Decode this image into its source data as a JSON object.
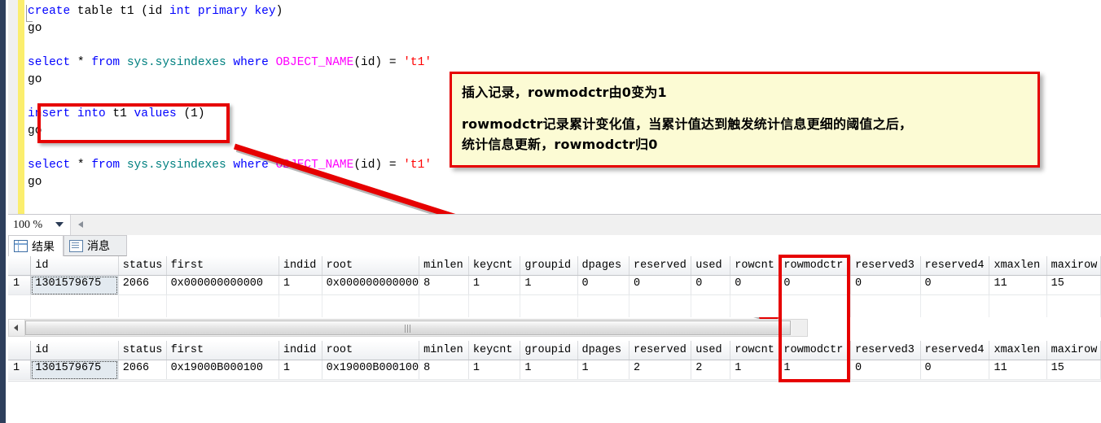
{
  "editor": {
    "lines": [
      [
        {
          "t": "create",
          "c": "kw"
        },
        {
          "t": " table t1 (id ",
          "c": "pl"
        },
        {
          "t": "int",
          "c": "kw"
        },
        {
          "t": " ",
          "c": "pl"
        },
        {
          "t": "primary key",
          "c": "kw"
        },
        {
          "t": ")",
          "c": "pl"
        }
      ],
      [
        {
          "t": "go",
          "c": "pl"
        }
      ],
      [],
      [
        {
          "t": "select",
          "c": "kw"
        },
        {
          "t": " * ",
          "c": "pl"
        },
        {
          "t": "from",
          "c": "kw"
        },
        {
          "t": " ",
          "c": "pl"
        },
        {
          "t": "sys.sysindexes",
          "c": "obj"
        },
        {
          "t": " ",
          "c": "pl"
        },
        {
          "t": "where",
          "c": "kw"
        },
        {
          "t": " ",
          "c": "pl"
        },
        {
          "t": "OBJECT_NAME",
          "c": "fn"
        },
        {
          "t": "(id) = ",
          "c": "pl"
        },
        {
          "t": "'t1'",
          "c": "str"
        }
      ],
      [
        {
          "t": "go",
          "c": "pl"
        }
      ],
      [],
      [
        {
          "t": "insert into",
          "c": "kw"
        },
        {
          "t": " t1 ",
          "c": "pl"
        },
        {
          "t": "values",
          "c": "kw"
        },
        {
          "t": " (1)",
          "c": "pl"
        }
      ],
      [
        {
          "t": "go",
          "c": "pl"
        }
      ],
      [],
      [
        {
          "t": "select",
          "c": "kw"
        },
        {
          "t": " * ",
          "c": "pl"
        },
        {
          "t": "from",
          "c": "kw"
        },
        {
          "t": " ",
          "c": "pl"
        },
        {
          "t": "sys.sysindexes",
          "c": "obj"
        },
        {
          "t": " ",
          "c": "pl"
        },
        {
          "t": "where",
          "c": "kw"
        },
        {
          "t": " ",
          "c": "pl"
        },
        {
          "t": "OBJECT_NAME",
          "c": "fn"
        },
        {
          "t": "(id) = ",
          "c": "pl"
        },
        {
          "t": "'t1'",
          "c": "str"
        }
      ],
      [
        {
          "t": "go",
          "c": "pl"
        }
      ]
    ],
    "highlight_statement": "insert into t1 values (1)"
  },
  "annotation": {
    "line1": "插入记录，rowmodctr由0变为1",
    "line2": "rowmodctr记录累计变化值，当累计值达到触发统计信息更细的阈值之后，",
    "line3": "统计信息更新，rowmodctr归0",
    "border_color": "#e60000",
    "background_color": "#fcfbd4"
  },
  "zoombar": {
    "zoom_value": "100 %"
  },
  "tabs": [
    {
      "label": "结果",
      "icon": "grid-icon",
      "active": true
    },
    {
      "label": "消息",
      "icon": "message-icon",
      "active": false
    }
  ],
  "results": {
    "columns": [
      "id",
      "status",
      "first",
      "indid",
      "root",
      "minlen",
      "keycnt",
      "groupid",
      "dpages",
      "reserved",
      "used",
      "rowcnt",
      "rowmodctr",
      "reserved3",
      "reserved4",
      "xmaxlen",
      "maxirow"
    ],
    "grid1": {
      "row_number": "1",
      "values": [
        "1301579675",
        "2066",
        "0x000000000000",
        "1",
        "0x000000000000",
        "8",
        "1",
        "1",
        "0",
        "0",
        "0",
        "0",
        "0",
        "0",
        "0",
        "11",
        "15"
      ]
    },
    "grid2": {
      "row_number": "1",
      "values": [
        "1301579675",
        "2066",
        "0x19000B000100",
        "1",
        "0x19000B000100",
        "8",
        "1",
        "1",
        "1",
        "2",
        "2",
        "1",
        "1",
        "0",
        "0",
        "11",
        "15"
      ]
    },
    "highlighted_column": "rowmodctr"
  }
}
